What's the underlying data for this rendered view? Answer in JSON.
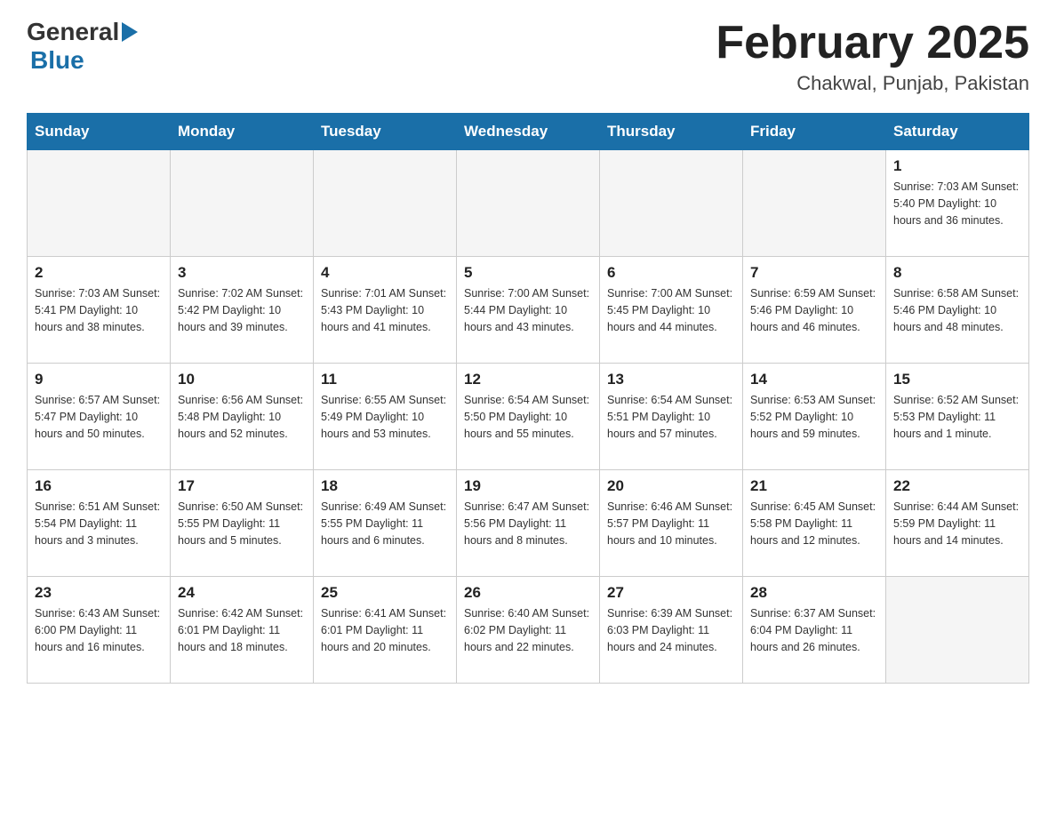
{
  "header": {
    "logo_general": "General",
    "logo_blue": "Blue",
    "title": "February 2025",
    "subtitle": "Chakwal, Punjab, Pakistan"
  },
  "weekdays": [
    "Sunday",
    "Monday",
    "Tuesday",
    "Wednesday",
    "Thursday",
    "Friday",
    "Saturday"
  ],
  "weeks": [
    [
      {
        "day": "",
        "info": ""
      },
      {
        "day": "",
        "info": ""
      },
      {
        "day": "",
        "info": ""
      },
      {
        "day": "",
        "info": ""
      },
      {
        "day": "",
        "info": ""
      },
      {
        "day": "",
        "info": ""
      },
      {
        "day": "1",
        "info": "Sunrise: 7:03 AM\nSunset: 5:40 PM\nDaylight: 10 hours and 36 minutes."
      }
    ],
    [
      {
        "day": "2",
        "info": "Sunrise: 7:03 AM\nSunset: 5:41 PM\nDaylight: 10 hours and 38 minutes."
      },
      {
        "day": "3",
        "info": "Sunrise: 7:02 AM\nSunset: 5:42 PM\nDaylight: 10 hours and 39 minutes."
      },
      {
        "day": "4",
        "info": "Sunrise: 7:01 AM\nSunset: 5:43 PM\nDaylight: 10 hours and 41 minutes."
      },
      {
        "day": "5",
        "info": "Sunrise: 7:00 AM\nSunset: 5:44 PM\nDaylight: 10 hours and 43 minutes."
      },
      {
        "day": "6",
        "info": "Sunrise: 7:00 AM\nSunset: 5:45 PM\nDaylight: 10 hours and 44 minutes."
      },
      {
        "day": "7",
        "info": "Sunrise: 6:59 AM\nSunset: 5:46 PM\nDaylight: 10 hours and 46 minutes."
      },
      {
        "day": "8",
        "info": "Sunrise: 6:58 AM\nSunset: 5:46 PM\nDaylight: 10 hours and 48 minutes."
      }
    ],
    [
      {
        "day": "9",
        "info": "Sunrise: 6:57 AM\nSunset: 5:47 PM\nDaylight: 10 hours and 50 minutes."
      },
      {
        "day": "10",
        "info": "Sunrise: 6:56 AM\nSunset: 5:48 PM\nDaylight: 10 hours and 52 minutes."
      },
      {
        "day": "11",
        "info": "Sunrise: 6:55 AM\nSunset: 5:49 PM\nDaylight: 10 hours and 53 minutes."
      },
      {
        "day": "12",
        "info": "Sunrise: 6:54 AM\nSunset: 5:50 PM\nDaylight: 10 hours and 55 minutes."
      },
      {
        "day": "13",
        "info": "Sunrise: 6:54 AM\nSunset: 5:51 PM\nDaylight: 10 hours and 57 minutes."
      },
      {
        "day": "14",
        "info": "Sunrise: 6:53 AM\nSunset: 5:52 PM\nDaylight: 10 hours and 59 minutes."
      },
      {
        "day": "15",
        "info": "Sunrise: 6:52 AM\nSunset: 5:53 PM\nDaylight: 11 hours and 1 minute."
      }
    ],
    [
      {
        "day": "16",
        "info": "Sunrise: 6:51 AM\nSunset: 5:54 PM\nDaylight: 11 hours and 3 minutes."
      },
      {
        "day": "17",
        "info": "Sunrise: 6:50 AM\nSunset: 5:55 PM\nDaylight: 11 hours and 5 minutes."
      },
      {
        "day": "18",
        "info": "Sunrise: 6:49 AM\nSunset: 5:55 PM\nDaylight: 11 hours and 6 minutes."
      },
      {
        "day": "19",
        "info": "Sunrise: 6:47 AM\nSunset: 5:56 PM\nDaylight: 11 hours and 8 minutes."
      },
      {
        "day": "20",
        "info": "Sunrise: 6:46 AM\nSunset: 5:57 PM\nDaylight: 11 hours and 10 minutes."
      },
      {
        "day": "21",
        "info": "Sunrise: 6:45 AM\nSunset: 5:58 PM\nDaylight: 11 hours and 12 minutes."
      },
      {
        "day": "22",
        "info": "Sunrise: 6:44 AM\nSunset: 5:59 PM\nDaylight: 11 hours and 14 minutes."
      }
    ],
    [
      {
        "day": "23",
        "info": "Sunrise: 6:43 AM\nSunset: 6:00 PM\nDaylight: 11 hours and 16 minutes."
      },
      {
        "day": "24",
        "info": "Sunrise: 6:42 AM\nSunset: 6:01 PM\nDaylight: 11 hours and 18 minutes."
      },
      {
        "day": "25",
        "info": "Sunrise: 6:41 AM\nSunset: 6:01 PM\nDaylight: 11 hours and 20 minutes."
      },
      {
        "day": "26",
        "info": "Sunrise: 6:40 AM\nSunset: 6:02 PM\nDaylight: 11 hours and 22 minutes."
      },
      {
        "day": "27",
        "info": "Sunrise: 6:39 AM\nSunset: 6:03 PM\nDaylight: 11 hours and 24 minutes."
      },
      {
        "day": "28",
        "info": "Sunrise: 6:37 AM\nSunset: 6:04 PM\nDaylight: 11 hours and 26 minutes."
      },
      {
        "day": "",
        "info": ""
      }
    ]
  ]
}
